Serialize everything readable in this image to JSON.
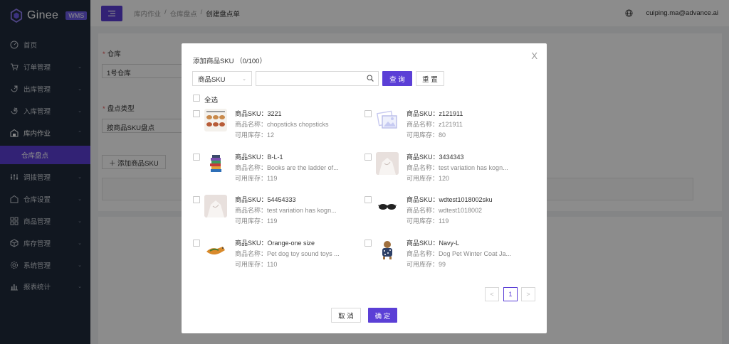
{
  "app": {
    "logo_text": "Ginee",
    "logo_badge": "WMS"
  },
  "sidebar": {
    "items": [
      {
        "label": "首页",
        "icon": "dashboard-icon",
        "chevron": false
      },
      {
        "label": "订单管理",
        "icon": "cart-icon",
        "chevron": true
      },
      {
        "label": "出库管理",
        "icon": "outbound-icon",
        "chevron": true
      },
      {
        "label": "入库管理",
        "icon": "inbound-icon",
        "chevron": true
      },
      {
        "label": "库内作业",
        "icon": "warehouse-op-icon",
        "chevron": true,
        "open": true
      },
      {
        "label": "调拨管理",
        "icon": "transfer-icon",
        "chevron": true
      },
      {
        "label": "仓库设置",
        "icon": "warehouse-icon",
        "chevron": true
      },
      {
        "label": "商品管理",
        "icon": "product-icon",
        "chevron": true
      },
      {
        "label": "库存管理",
        "icon": "box-icon",
        "chevron": true
      },
      {
        "label": "系统管理",
        "icon": "gear-icon",
        "chevron": true
      },
      {
        "label": "报表统计",
        "icon": "bar-chart-icon",
        "chevron": true
      }
    ],
    "active_sub": "仓库盘点"
  },
  "header": {
    "breadcrumb": [
      "库内作业",
      "仓库盘点",
      "创建盘点单"
    ],
    "separator": "/",
    "user": "cuiping.ma@advance.ai"
  },
  "form": {
    "warehouse_label": "仓库",
    "warehouse_value": "1号仓库",
    "type_label": "盘点类型",
    "type_value": "按商品SKU盘点",
    "add_sku_label": "添加商品SKU",
    "required_mark": "*"
  },
  "modal": {
    "title": "添加商品SKU （0/100）",
    "close": "X",
    "filter_select": "商品SKU",
    "search_placeholder": "",
    "query_label": "查 询",
    "reset_label": "重 置",
    "select_all": "全选",
    "sku_prefix": "商品SKU：",
    "name_prefix": "商品名称：",
    "stock_prefix": "可用库存：",
    "items": [
      {
        "sku": "3221",
        "name": "chopsticks chopsticks",
        "stock": "12",
        "thumb": "food"
      },
      {
        "sku": "z121911",
        "name": "z121911",
        "stock": "80",
        "thumb": "placeholder"
      },
      {
        "sku": "B-L-1",
        "name": "Books are the ladder of...",
        "stock": "119",
        "thumb": "books"
      },
      {
        "sku": "3434343",
        "name": "test variation has kogn...",
        "stock": "120",
        "thumb": "shirt"
      },
      {
        "sku": "54454333",
        "name": "test variation has kogn...",
        "stock": "119",
        "thumb": "shirt"
      },
      {
        "sku": "wdtest1018002sku",
        "name": "wdtest1018002",
        "stock": "119",
        "thumb": "sunglasses"
      },
      {
        "sku": "Orange-one size",
        "name": "Pet dog toy sound toys ...",
        "stock": "110",
        "thumb": "toy"
      },
      {
        "sku": "Navy-L",
        "name": "Dog Pet Winter Coat Ja...",
        "stock": "99",
        "thumb": "dog"
      }
    ],
    "pager": {
      "prev": "<",
      "current": "1",
      "next": ">"
    },
    "cancel_label": "取 消",
    "confirm_label": "确 定"
  },
  "colors": {
    "brand": "#5b3fd6",
    "sidebar_bg": "#1f2a3b"
  }
}
